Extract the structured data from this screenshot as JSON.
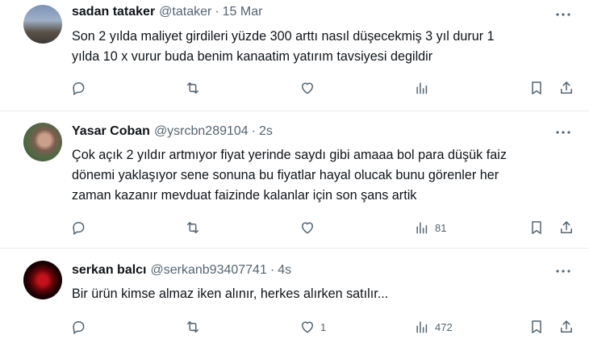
{
  "tweets": [
    {
      "name": "sadan tataker",
      "handle": "@tataker",
      "dot": "·",
      "time": "15 Mar",
      "lines": [
        "Son 2 yılda maliyet girdileri yüzde 300 arttı nasıl düşecekmiş 3 yıl durur 1",
        "yılda 10 x vurur buda benim kanaatim yatırım tavsiyesi degildir"
      ],
      "replies": "",
      "retweets": "",
      "likes": "",
      "views": ""
    },
    {
      "name": "Yasar Coban",
      "handle": "@ysrcbn289104",
      "dot": "·",
      "time": "2s",
      "lines": [
        "Çok açık 2 yıldır artmıyor fiyat yerinde saydı gibi amaaa bol para düşük faiz",
        "dönemi yaklaşıyor sene sonuna bu fiyatlar hayal olucak bunu görenler her",
        "zaman kazanır mevduat faizinde kalanlar için son şans artik"
      ],
      "replies": "",
      "retweets": "",
      "likes": "",
      "views": "81"
    },
    {
      "name": "serkan balcı",
      "handle": "@serkanb93407741",
      "dot": "·",
      "time": "4s",
      "lines": [
        "Bir ürün kimse almaz iken alınır, herkes alırken satılır..."
      ],
      "replies": "",
      "retweets": "",
      "likes": "1",
      "views": "472"
    }
  ],
  "icons": {
    "reply": "reply-icon",
    "retweet": "retweet-icon",
    "like": "heart-icon",
    "views": "views-chart-icon",
    "bookmark": "bookmark-icon",
    "share": "share-icon",
    "more": "more-dots-icon"
  },
  "colors": {
    "text": "#0f1419",
    "secondary": "#536471",
    "divider": "#e6ecf0"
  }
}
